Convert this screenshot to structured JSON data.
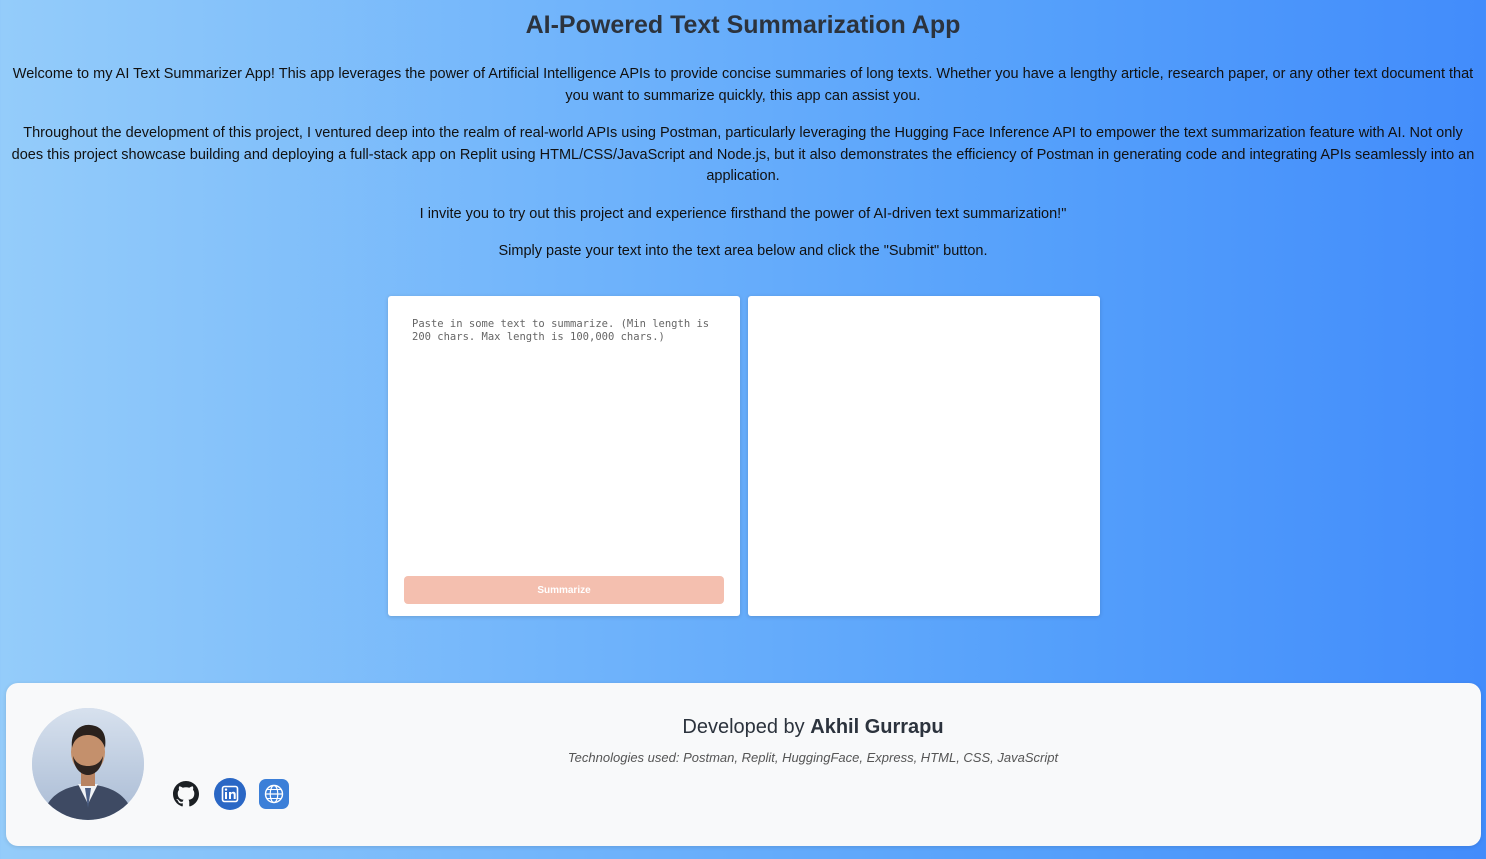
{
  "header": {
    "title": "AI-Powered Text Summarization App"
  },
  "intro": {
    "p1": "Welcome to my AI Text Summarizer App! This app leverages the power of Artificial Intelligence APIs to provide concise summaries of long texts. Whether you have a lengthy article, research paper, or any other text document that you want to summarize quickly, this app can assist you.",
    "p2": "Throughout the development of this project, I ventured deep into the realm of real-world APIs using Postman, particularly leveraging the Hugging Face Inference API to empower the text summarization feature with AI. Not only does this project showcase building and deploying a full-stack app on Replit using HTML/CSS/JavaScript and Node.js, but it also demonstrates the efficiency of Postman in generating code and integrating APIs seamlessly into an application.",
    "p3": "I invite you to try out this project and experience firsthand the power of AI-driven text summarization!\"",
    "p4": "Simply paste your text into the text area below and click the \"Submit\" button."
  },
  "summarizer": {
    "input_placeholder": "Paste in some text to summarize. (Min length is 200 chars. Max length is 100,000 chars.)",
    "input_value": "",
    "button_label": "Summarize",
    "button_color": "#f4bfaf",
    "output_text": ""
  },
  "footer": {
    "developed_by_prefix": "Developed by",
    "developer_name": "Akhil Gurrapu",
    "technologies": "Technologies used: Postman, Replit, HuggingFace, Express, HTML, CSS, JavaScript",
    "avatar_icon": "profile-photo",
    "social": [
      {
        "name": "github",
        "icon": "github-icon"
      },
      {
        "name": "linkedin",
        "icon": "linkedin-icon",
        "color": "#2a67c5"
      },
      {
        "name": "website",
        "icon": "globe-icon",
        "color": "#3b7fd8"
      }
    ]
  },
  "colors": {
    "background_start": "#94ccfa",
    "background_end": "#428cfb",
    "title": "#2c333d",
    "footer_bg": "#f8f9fa"
  }
}
